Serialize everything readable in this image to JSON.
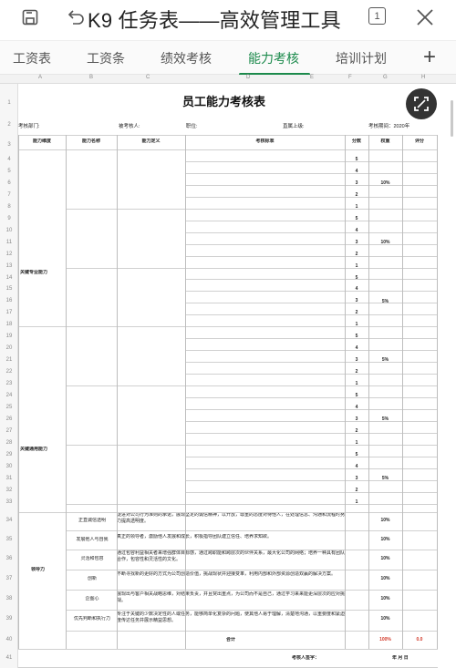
{
  "app": {
    "doc_title": "K9 任务表——高效管理工具",
    "page_badge": "1"
  },
  "tabs": [
    {
      "label": "工资表",
      "active": false
    },
    {
      "label": "工资条",
      "active": false
    },
    {
      "label": "绩效考核",
      "active": false
    },
    {
      "label": "能力考核",
      "active": true
    },
    {
      "label": "培训计划",
      "active": false
    }
  ],
  "columns": [
    "A",
    "B",
    "C",
    "D",
    "E",
    "F",
    "G",
    "H"
  ],
  "row_numbers": [
    "1",
    "2",
    "3",
    "4",
    "5",
    "6",
    "7",
    "8",
    "9",
    "10",
    "11",
    "12",
    "13",
    "14",
    "15",
    "16",
    "17",
    "18",
    "19",
    "20",
    "21",
    "22",
    "23",
    "24",
    "25",
    "26",
    "27",
    "28",
    "29",
    "30",
    "31",
    "32",
    "33",
    "34",
    "35",
    "36",
    "37",
    "38",
    "39",
    "40",
    "41"
  ],
  "sheet": {
    "title": "员工能力考核表",
    "meta": {
      "dept": "考核部门:",
      "person": "被考核人:",
      "position": "职位:",
      "superior": "直属上级:",
      "period": "考核期间：2020年"
    },
    "headers": [
      "能力维度",
      "能力名称",
      "能力定义",
      "考核标准",
      "分数",
      "权重",
      "评分"
    ],
    "scores": [
      "5",
      "4",
      "3",
      "2",
      "1"
    ],
    "groups": [
      {
        "dimension": "关键专业能力",
        "weights": [
          "10%",
          "10%",
          "5%",
          "5%"
        ]
      },
      {
        "dimension": "关键通用能力",
        "weights": [
          "5%",
          "5%"
        ]
      }
    ],
    "leadership": {
      "dimension": "领导力",
      "items": [
        {
          "name": "正直诚信透明",
          "definition": "促进对公司行为准则的承诺，展现坚定的诚信精神，以开放，尊重的态度对待他人，在处理信息、沟通和流程时努力提高透明度。",
          "weight": "10%"
        },
        {
          "name": "发展他人与自我",
          "definition": "真正的领导者，激励他人发展和成长，积极指导团队建立信任、培养求知欲。",
          "weight": "10%"
        },
        {
          "name": "灵活和包容",
          "definition": "通过包容利益相关者来增强群体目标感，通过跨职能和跨层次的伙伴关系，最大化公司的网络；培养一种具有团队合作，包容性和灵活性的文化。",
          "weight": "10%"
        },
        {
          "name": "创新",
          "definition": "不断寻找新的更好的方式为公司创造价值，挑战现状并迎接变革，利用内部和外部资源创造双赢的解决方案。",
          "weight": "10%"
        },
        {
          "name": "企图心",
          "definition": "展现出与客户相关战略思维，对结果负责，并且突出重点，为公司而不是自己，通过学习来来能更深层次的应对挑战。",
          "weight": "10%"
        },
        {
          "name": "优先判断和执行力",
          "definition": "专注于关键的少数决定性的人或任务，能够简单化复杂的问题，使其他人易于理解，清楚地沟通，以重要度和紧迫度传达任务并展示精益思想。",
          "weight": "10%"
        }
      ]
    },
    "total": {
      "label": "合计",
      "weight": "100%",
      "score": "0.0"
    },
    "footer": {
      "signature": "考核人签字：",
      "date": "年  月  日"
    }
  }
}
